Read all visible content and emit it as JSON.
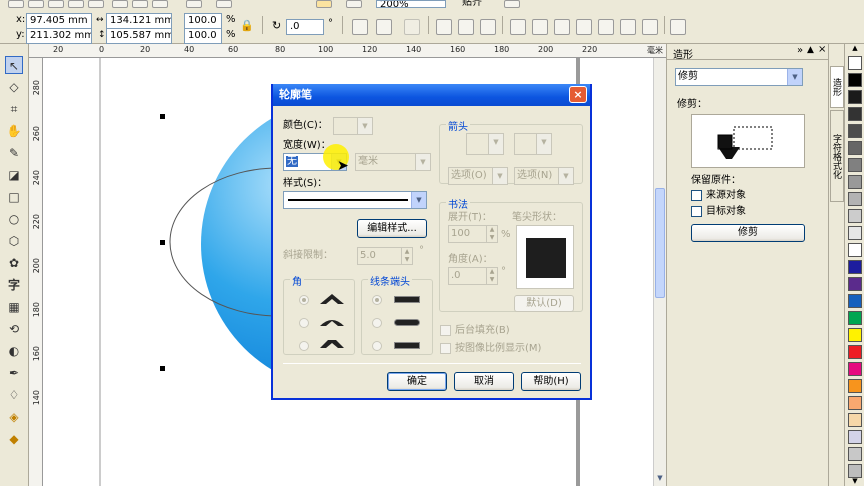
{
  "topbar": {
    "x_label": "x:",
    "x_value": "97.405 mm",
    "y_label": "y:",
    "y_value": "211.302 mm",
    "w_value": "134.121 mm",
    "h_value": "105.587 mm",
    "scale_x": "100.0",
    "scale_y": "100.0",
    "pct": "%",
    "rotation": ".0",
    "deg": "°",
    "zoom": "200%",
    "snap": "贴齐"
  },
  "ruler": {
    "h_ticks": [
      "20",
      "0",
      "20",
      "40",
      "60",
      "80",
      "100",
      "120",
      "140",
      "160",
      "180",
      "200",
      "220"
    ],
    "h_unit": "毫米",
    "v_ticks": [
      "280",
      "260",
      "240",
      "220",
      "200",
      "180",
      "160",
      "140"
    ]
  },
  "dialog": {
    "title": "轮廓笔",
    "close": "×",
    "color_label": "颜色(C)：",
    "width_label": "宽度(W)：",
    "width_value": "无",
    "unit_value": "毫米",
    "style_label": "样式(S)：",
    "edit_style_button": "编辑样式...",
    "miter_label": "斜接限制：",
    "miter_value": "5.0",
    "miter_deg": "°",
    "corner_group": "角",
    "cap_group": "线条端头",
    "arrow_group": "箭头",
    "arrow_options_left": "选项(O)",
    "arrow_options_right": "选项(N)",
    "calligraphy_group": "书法",
    "stretch_label": "展开(T)：",
    "stretch_value": "100",
    "stretch_pct": "%",
    "angle_label": "角度(A)：",
    "angle_value": ".0",
    "angle_deg": "°",
    "nib_label": "笔尖形状：",
    "default_button": "默认(D)",
    "behind_fill": "后台填充(B)",
    "scale_with_image": "按图像比例显示(M)",
    "ok_button": "确定",
    "cancel_button": "取消",
    "help_button": "帮助(H)"
  },
  "docker": {
    "title": "造形",
    "mode": "修剪",
    "section_label": "修剪：",
    "keep_label": "保留原件：",
    "source_label": "来源对象",
    "target_label": "目标对象",
    "trim_button": "修剪",
    "tab_shaping": "造形",
    "tab_char": "字符格式化"
  },
  "palette": {
    "colors": [
      "#ffffff",
      "#000000",
      "#1a1a1a",
      "#333333",
      "#4d4d4d",
      "#666666",
      "#808080",
      "#999999",
      "#b3b3b3",
      "#cccccc",
      "#e6e6e6",
      "#ffffff",
      "#1d1d9e",
      "#5b2b8c",
      "#1560bd",
      "#00a651",
      "#fff200",
      "#ed1c24",
      "#e5097f",
      "#f7941d",
      "#f9a870",
      "#f6d7a8",
      "#d3d3e8",
      "#c8c8c8",
      "#bdbdbd"
    ]
  }
}
